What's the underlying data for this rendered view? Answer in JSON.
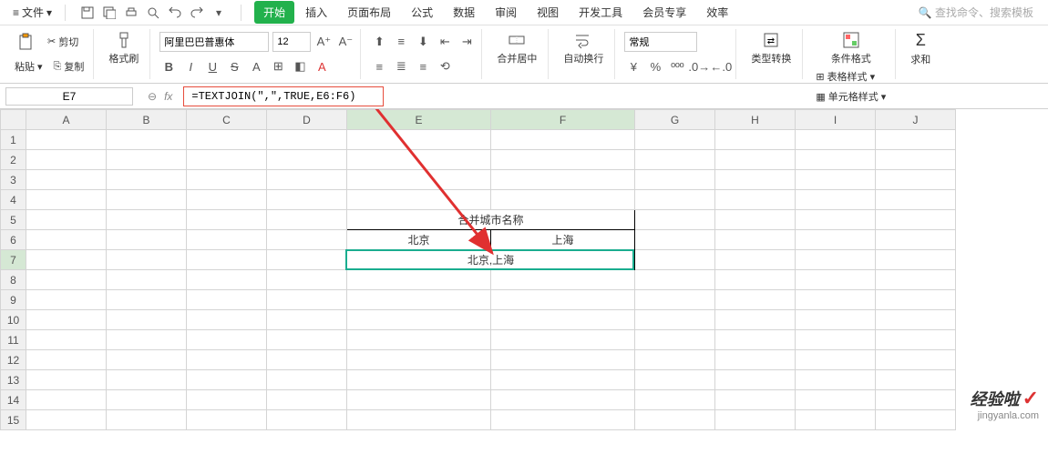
{
  "menubar": {
    "file": "文件",
    "tabs": [
      "开始",
      "插入",
      "页面布局",
      "公式",
      "数据",
      "审阅",
      "视图",
      "开发工具",
      "会员专享",
      "效率"
    ],
    "active_tab": 0,
    "search_placeholder": "查找命令、搜索模板"
  },
  "ribbon": {
    "paste": "粘贴",
    "cut": "剪切",
    "copy": "复制",
    "format_painter": "格式刷",
    "font_name": "阿里巴巴普惠体",
    "font_size": "12",
    "bold": "B",
    "italic": "I",
    "underline": "U",
    "merge_center": "合并居中",
    "wrap_text": "自动换行",
    "number_format": "常规",
    "type_convert": "类型转换",
    "cond_format": "条件格式",
    "table_style": "表格样式",
    "cell_style": "单元格样式",
    "sum": "求和"
  },
  "formula_bar": {
    "name_box": "E7",
    "fx": "fx",
    "formula": "=TEXTJOIN(\",\",TRUE,E6:F6)"
  },
  "grid": {
    "columns": [
      "A",
      "B",
      "C",
      "D",
      "E",
      "F",
      "G",
      "H",
      "I",
      "J"
    ],
    "rows": 15,
    "cells": {
      "E5_F5": "合并城市名称",
      "E6": "北京",
      "F6": "上海",
      "E7_F7": "北京,上海"
    },
    "selected": "E7"
  },
  "watermark": {
    "brand": "经验啦",
    "url": "jingyanla.com"
  }
}
